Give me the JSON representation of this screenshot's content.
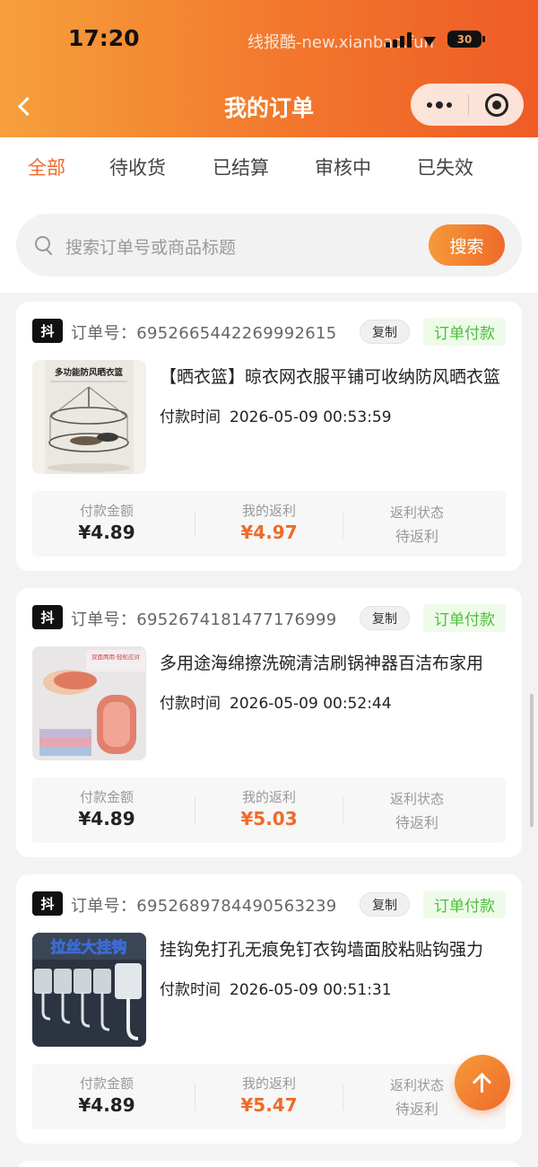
{
  "status_bar": {
    "time": "17:20",
    "watermark": "线报酷-new.xianbao.fun",
    "battery": "30"
  },
  "header": {
    "title": "我的订单"
  },
  "tabs": [
    {
      "label": "全部",
      "active": true
    },
    {
      "label": "待收货",
      "active": false
    },
    {
      "label": "已结算",
      "active": false
    },
    {
      "label": "审核中",
      "active": false
    },
    {
      "label": "已失效",
      "active": false
    }
  ],
  "search": {
    "placeholder": "搜索订单号或商品标题",
    "button_label": "搜索"
  },
  "labels": {
    "order_no_prefix": "订单号：",
    "copy": "复制",
    "pay_time": "付款时间",
    "pay_amount": "付款金额",
    "my_rebate": "我的返利",
    "rebate_status": "返利状态"
  },
  "orders": [
    {
      "platform": "抖",
      "order_no": "6952665442269992615",
      "status": "订单付款",
      "title": "【晒衣篮】晾衣网衣服平铺可收纳防风晒衣篮",
      "thumb_text": "多功能防风晒衣篮",
      "pay_time": "2026-05-09 00:53:59",
      "amount": "¥4.89",
      "rebate": "¥4.97",
      "rebate_status": "待返利"
    },
    {
      "platform": "抖",
      "order_no": "6952674181477176999",
      "status": "订单付款",
      "title": "多用途海绵擦洗碗清洁刷锅神器百洁布家用",
      "thumb_text": "双面两用·轻松应对",
      "pay_time": "2026-05-09 00:52:44",
      "amount": "¥4.89",
      "rebate": "¥5.03",
      "rebate_status": "待返利"
    },
    {
      "platform": "抖",
      "order_no": "6952689784490563239",
      "status": "订单付款",
      "title": "挂钩免打孔无痕免钉衣钩墙面胶粘贴钩强力",
      "thumb_text": "拉丝大挂钩",
      "pay_time": "2026-05-09 00:51:31",
      "amount": "¥4.89",
      "rebate": "¥5.47",
      "rebate_status": "待返利"
    }
  ]
}
